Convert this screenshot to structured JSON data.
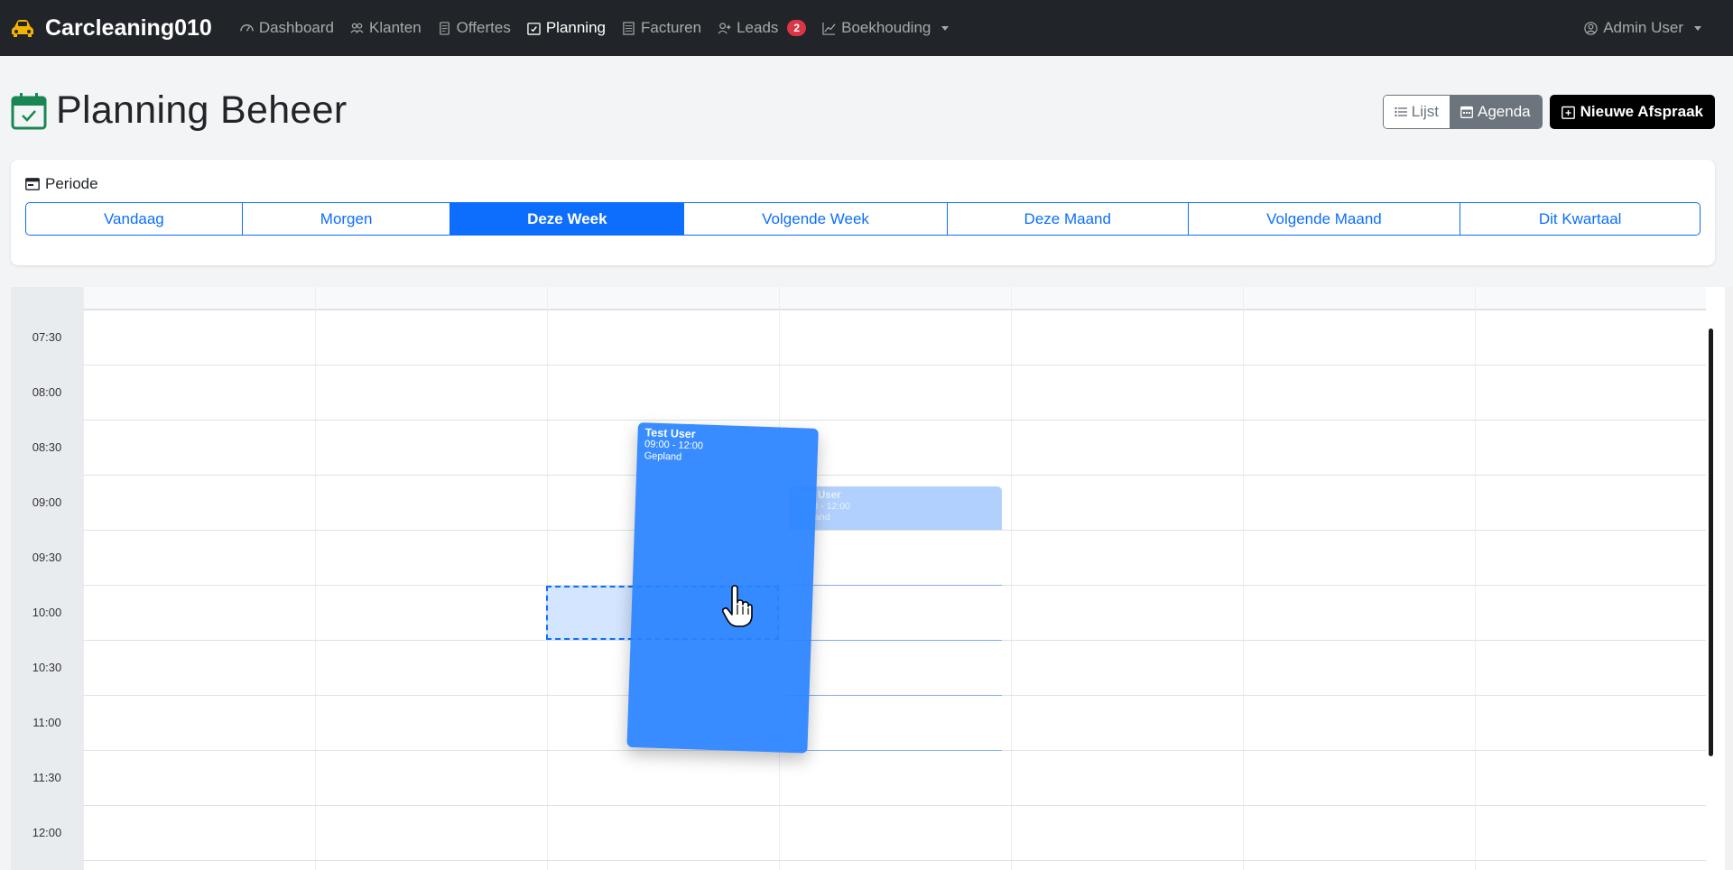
{
  "navbar": {
    "brand": "Carcleaning010",
    "items": [
      {
        "label": "Dashboard",
        "icon": "speedometer-icon"
      },
      {
        "label": "Klanten",
        "icon": "people-icon"
      },
      {
        "label": "Offertes",
        "icon": "document-icon"
      },
      {
        "label": "Planning",
        "icon": "calendar-check-icon",
        "active": true
      },
      {
        "label": "Facturen",
        "icon": "receipt-icon"
      },
      {
        "label": "Leads",
        "icon": "person-plus-icon",
        "badge": "2"
      },
      {
        "label": "Boekhouding",
        "icon": "graph-icon",
        "dropdown": true
      }
    ],
    "user": "Admin User"
  },
  "header": {
    "title": "Planning Beheer",
    "view_list": "Lijst",
    "view_agenda": "Agenda",
    "new_button": "Nieuwe Afspraak"
  },
  "period": {
    "label": "Periode",
    "tabs": [
      "Vandaag",
      "Morgen",
      "Deze Week",
      "Volgende Week",
      "Deze Maand",
      "Volgende Maand",
      "Dit Kwartaal"
    ],
    "active": "Deze Week"
  },
  "calendar": {
    "times": [
      "07:30",
      "08:00",
      "08:30",
      "09:00",
      "09:30",
      "10:00",
      "10:30",
      "11:00",
      "11:30",
      "12:00"
    ],
    "dragged_event": {
      "name": "Test User",
      "time": "09:00 - 12:00",
      "status": "Gepland"
    },
    "ghost_event": {
      "name": "Test User",
      "time": "09:00 - 12:00",
      "status": "Gepland"
    }
  },
  "colors": {
    "primary": "#0d6efd",
    "navbar": "#212529",
    "brand_icon": "#f5b301",
    "danger": "#dc3545"
  }
}
